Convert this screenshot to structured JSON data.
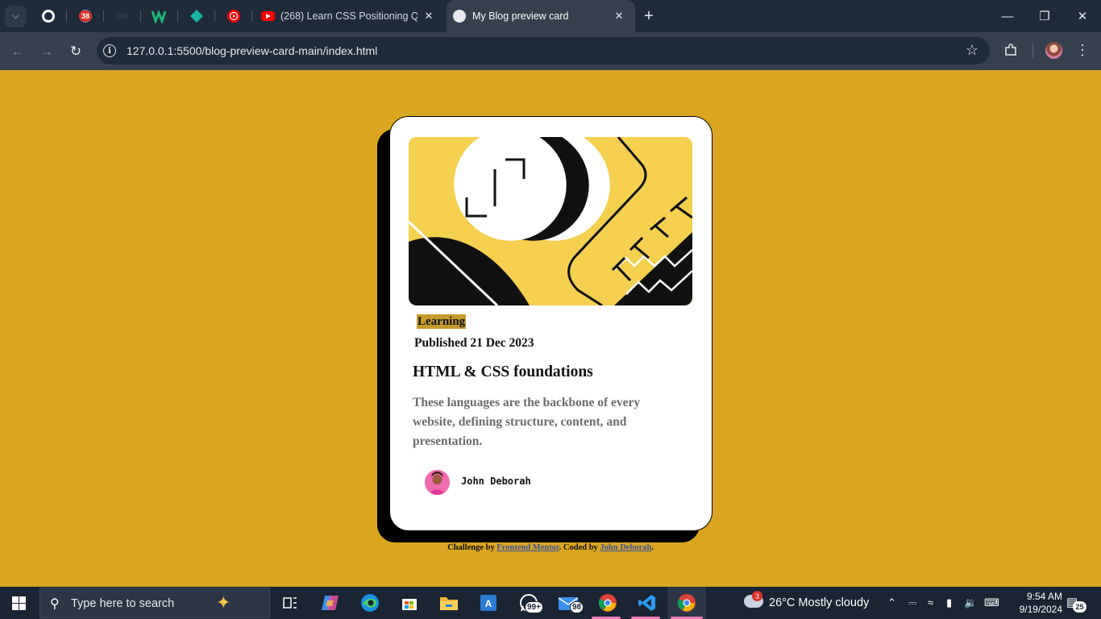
{
  "browser": {
    "pinned_tabs": [
      {
        "icon": "github-icon"
      },
      {
        "icon": "notification-app-icon",
        "badge": "38"
      },
      {
        "icon": "dark-site-icon"
      },
      {
        "icon": "w-logo-icon"
      },
      {
        "icon": "teal-diamond-icon"
      },
      {
        "icon": "youtube-music-icon"
      }
    ],
    "tabs": [
      {
        "title": "(268) Learn CSS Positioning Qu",
        "icon": "youtube-icon",
        "close": "✕",
        "active": false
      },
      {
        "title": "My Blog preview card",
        "icon": "globe-icon",
        "close": "✕",
        "active": true
      }
    ],
    "new_tab": "+",
    "window_controls": {
      "minimize": "—",
      "restore": "❐",
      "close": "✕"
    },
    "url": "127.0.0.1:5500/blog-preview-card-main/index.html",
    "info_icon_label": "i",
    "star": "☆",
    "menu": "⋮"
  },
  "card": {
    "tag": "Learning",
    "published": "Published 21 Dec 2023",
    "title": "HTML & CSS foundations",
    "description": "These languages are the backbone of every website, defining structure, content, and presentation.",
    "author": "John Deborah"
  },
  "attribution": {
    "prefix": "Challenge by ",
    "link1": "Frontend Mentor",
    "middle": ". Coded by ",
    "link2": "John Deborah",
    "suffix": "."
  },
  "taskbar": {
    "search_placeholder": "Type here to search",
    "apps": [
      {
        "name": "task-view",
        "badge": ""
      },
      {
        "name": "copilot",
        "badge": ""
      },
      {
        "name": "edge",
        "badge": ""
      },
      {
        "name": "microsoft-store",
        "badge": ""
      },
      {
        "name": "file-explorer",
        "badge": ""
      },
      {
        "name": "word",
        "badge": ""
      },
      {
        "name": "whatsapp",
        "badge": "99+"
      },
      {
        "name": "mail",
        "badge": "98"
      },
      {
        "name": "chrome",
        "badge": ""
      },
      {
        "name": "vscode",
        "badge": ""
      },
      {
        "name": "chrome-active",
        "badge": ""
      }
    ],
    "weather": {
      "badge": "3",
      "text": "26°C  Mostly cloudy"
    },
    "time": "9:54 AM",
    "date": "9/19/2024",
    "notifications": "25"
  },
  "colors": {
    "page_bg": "#daa520",
    "card_bg": "#ffffff",
    "tag_bg": "#c79a2c",
    "hero_yellow": "#f4d04e",
    "link": "#3e52a3",
    "desc_text": "#6b6b6b"
  }
}
